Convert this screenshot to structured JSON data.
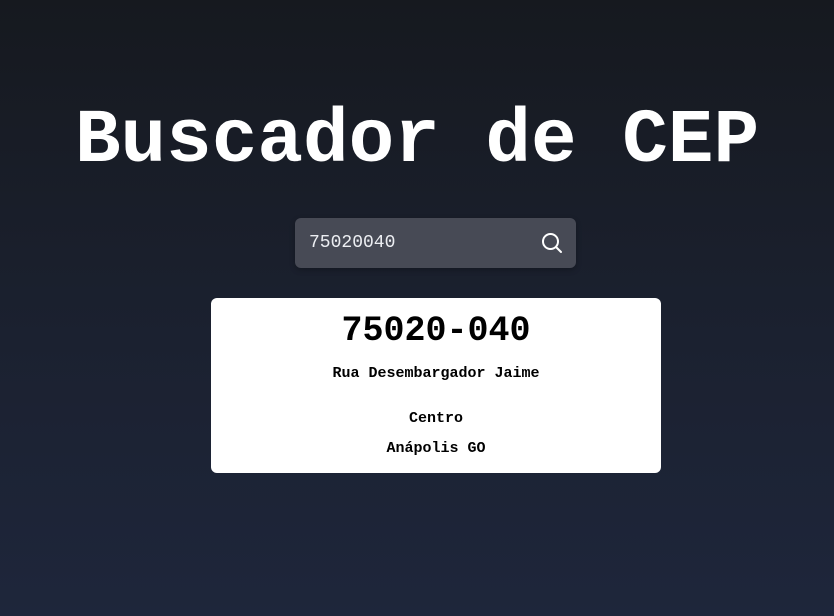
{
  "header": {
    "title": "Buscador de CEP"
  },
  "search": {
    "value": "75020040",
    "icon": "search-icon"
  },
  "result": {
    "cep": "75020-040",
    "street": "Rua Desembargador Jaime",
    "district": "Centro",
    "city": "Anápolis GO"
  },
  "colors": {
    "background_top": "#16191f",
    "background_bottom": "#1e263b",
    "search_bg": "#474a55",
    "card_bg": "#ffffff"
  }
}
